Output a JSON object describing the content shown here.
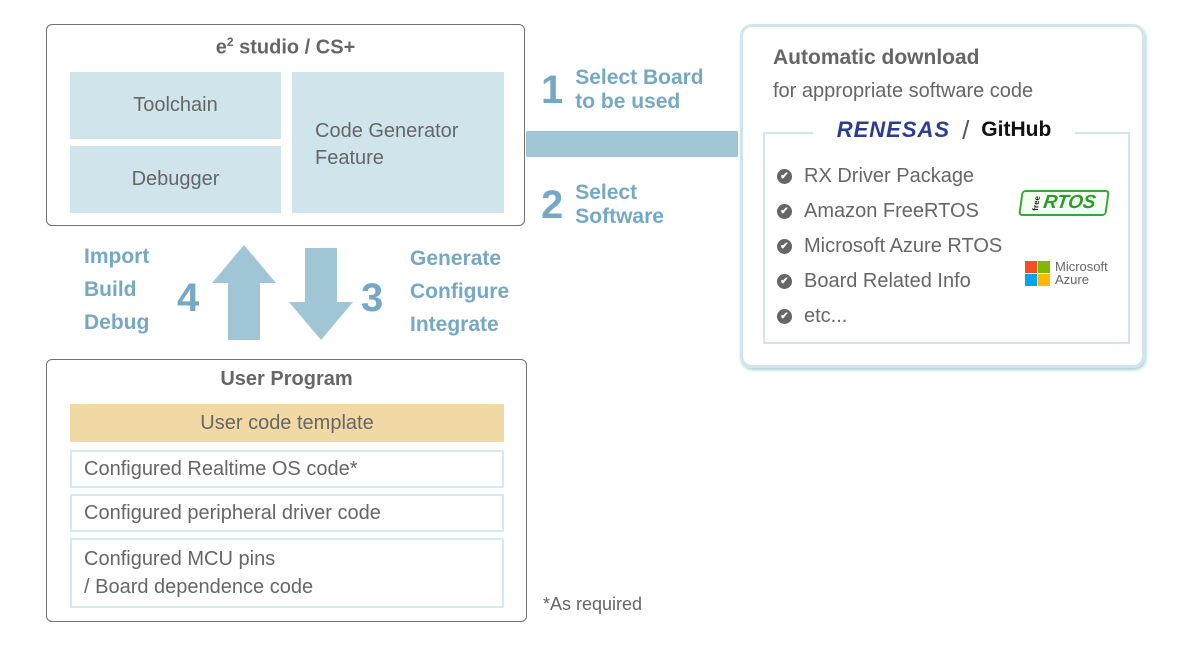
{
  "colors": {
    "light_blue_block": "#cfe4eb",
    "accent_blue": "#75a8c4",
    "connector_blue": "#a0c6d6",
    "template_tan": "#f1d9a6",
    "text_gray": "#666666",
    "renesas_blue": "#2a3c93",
    "freertos_green": "#3aa63a"
  },
  "ide": {
    "title_base": "e",
    "title_sup": "2",
    "title_rest": " studio / CS+",
    "blocks": {
      "toolchain": "Toolchain",
      "debugger": "Debugger",
      "codegen_line1": "Code Generator",
      "codegen_line2": "Feature"
    }
  },
  "steps": {
    "s1": {
      "num": "1",
      "line1": "Select Board",
      "line2": "to be used"
    },
    "s2": {
      "num": "2",
      "line1": "Select",
      "line2": "Software"
    },
    "s3": {
      "num": "3",
      "lines": [
        "Generate",
        "Configure",
        "Integrate"
      ]
    },
    "s4": {
      "num": "4",
      "lines": [
        "Import",
        "Build",
        "Debug"
      ]
    }
  },
  "download": {
    "title": "Automatic download",
    "subtitle": "for appropriate software code",
    "logo_renesas": "RENESAS",
    "logo_sep": "/",
    "logo_github": "GitHub",
    "items": [
      "RX Driver Package",
      "Amazon FreeRTOS",
      "Microsoft Azure RTOS",
      "Board Related Info",
      "etc..."
    ],
    "freertos_free": "free",
    "freertos_rtos": "RTOS",
    "azure_line1": "Microsoft",
    "azure_line2": "Azure",
    "check_icon": "✔"
  },
  "user_program": {
    "title": "User Program",
    "template": "User code template",
    "rows": [
      "Configured Realtime OS code*",
      "Configured peripheral driver code"
    ],
    "mcu_line1": "Configured MCU pins",
    "mcu_line2": "/ Board dependence code"
  },
  "footnote": "*As required"
}
